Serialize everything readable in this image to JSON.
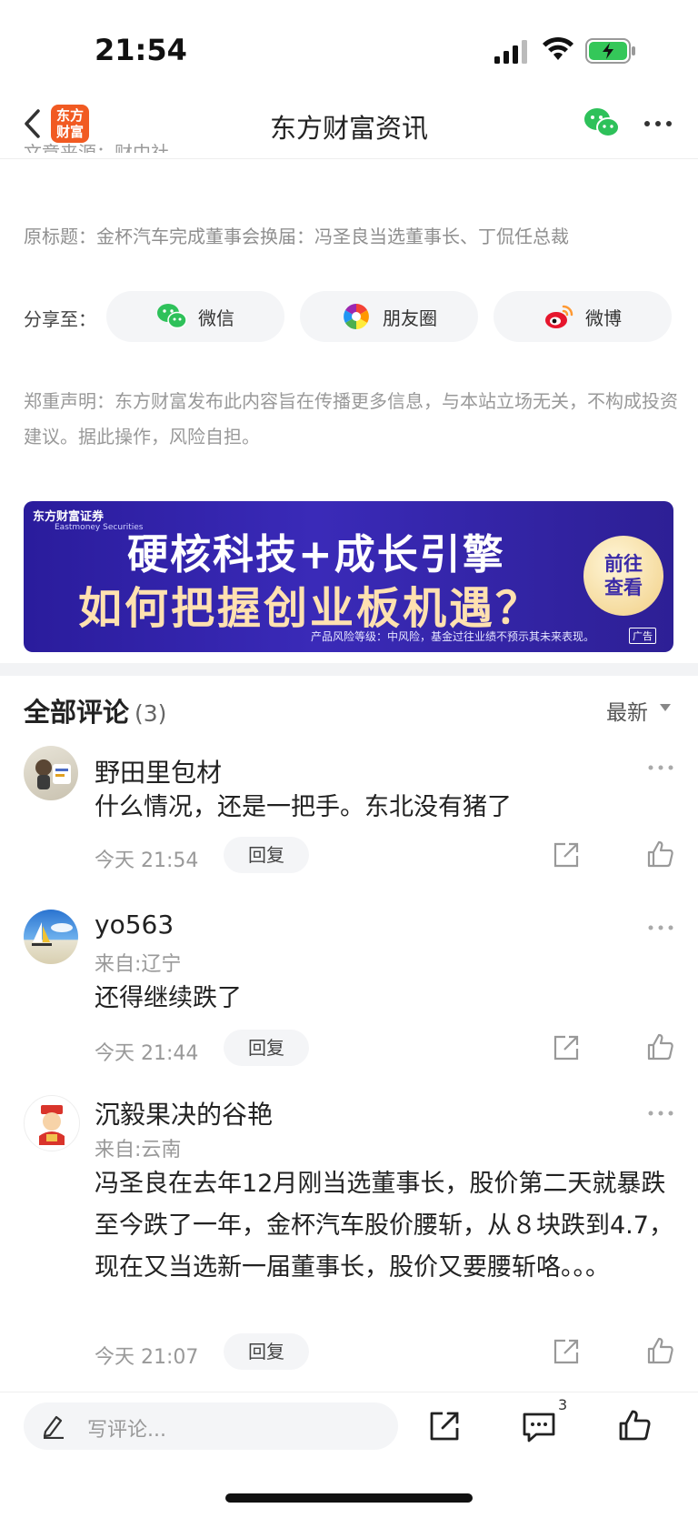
{
  "status_bar": {
    "time": "21:54"
  },
  "nav": {
    "logo_text_1": "东方",
    "logo_text_2": "财富",
    "title": "东方财富资讯"
  },
  "article": {
    "source": "文章来源：财中社",
    "original_title": "原标题：金杯汽车完成董事会换届：冯圣良当选董事长、丁侃任总裁",
    "share_label": "分享至：",
    "share_targets": [
      {
        "label": "微信",
        "icon": "wechat-icon"
      },
      {
        "label": "朋友圈",
        "icon": "moments-icon"
      },
      {
        "label": "微博",
        "icon": "weibo-icon"
      }
    ],
    "disclaimer": "郑重声明：东方财富发布此内容旨在传播更多信息，与本站立场无关，不构成投资建议。据此操作，风险自担。"
  },
  "ad": {
    "brand": "东方财富证券",
    "brand_en": "Eastmoney Securities",
    "line1": "硬核科技+成长引擎",
    "line2": "如何把握创业板机遇？",
    "cta_1": "前往",
    "cta_2": "查看",
    "risk_note": "产品风险等级：中风险，基金过往业绩不预示其未来表现。",
    "tag": "广告"
  },
  "comments_section": {
    "title": "全部评论",
    "count": "(3)",
    "sort": "最新",
    "items": [
      {
        "name": "野田里包材",
        "location": "",
        "text": "什么情况，还是一把手。东北没有猪了",
        "time": "今天 21:54",
        "reply": "回复"
      },
      {
        "name": "yo563",
        "location": "来自:辽宁",
        "text": "还得继续跌了",
        "time": "今天 21:44",
        "reply": "回复"
      },
      {
        "name": "沉毅果决的谷艳",
        "location": "来自:云南",
        "text": "冯圣良在去年12月刚当选董事长，股价第二天就暴跌至今跌了一年，金杯汽车股价腰斩，从８块跌到4.7，现在又当选新一届董事长，股价又要腰斩咯。。。",
        "time": "今天 21:07",
        "reply": "回复"
      }
    ]
  },
  "bottom_bar": {
    "placeholder": "写评论...",
    "comment_badge": "3"
  },
  "colors": {
    "brand_orange": "#f15a22",
    "ad_purple": "#2d1f95",
    "wechat_green": "#2ec15a"
  }
}
